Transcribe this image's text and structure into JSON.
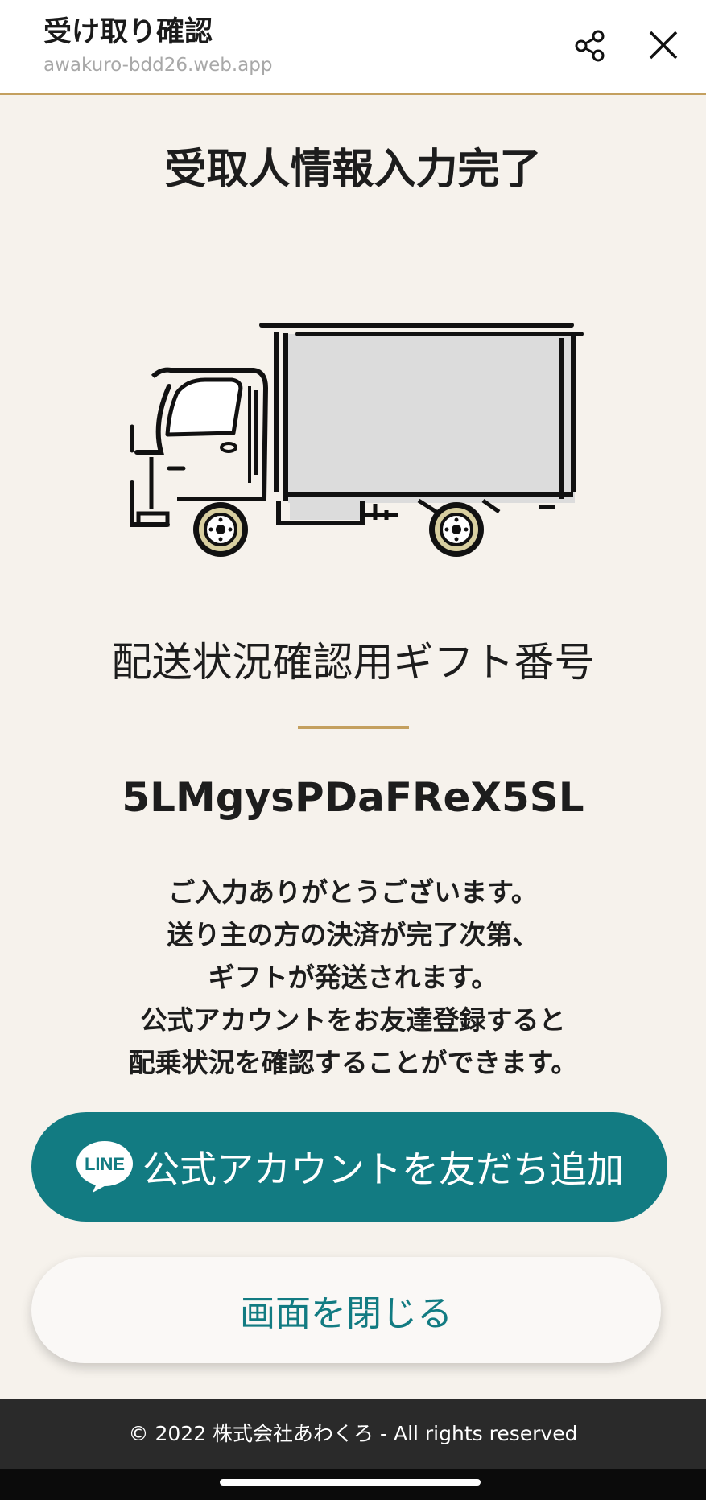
{
  "header": {
    "title": "受け取り確認",
    "url": "awakuro-bdd26.web.app",
    "share_icon": "share-icon",
    "close_icon": "close-icon"
  },
  "main": {
    "title": "受取人情報入力完了",
    "illustration": "delivery-truck-illustration",
    "gift_label": "配送状況確認用ギフト番号",
    "gift_code": "5LMgysPDaFReX5SL",
    "message_lines": [
      "ご入力ありがとうございます。",
      "送り主の方の決済が完了次第、",
      "ギフトが発送されます。",
      "公式アカウントをお友達登録すると",
      "配乗状況を確認することができます。"
    ],
    "line_button": {
      "logo_text": "LINE",
      "label": "公式アカウントを友だち追加"
    },
    "close_button_label": "画面を閉じる"
  },
  "footer": {
    "copyright": "© 2022 株式会社あわくろ - All rights reserved"
  },
  "colors": {
    "accent_gold": "#c4a05f",
    "line_teal": "#127b82",
    "background": "#f6f2ec",
    "footer": "#2a2a2a"
  }
}
